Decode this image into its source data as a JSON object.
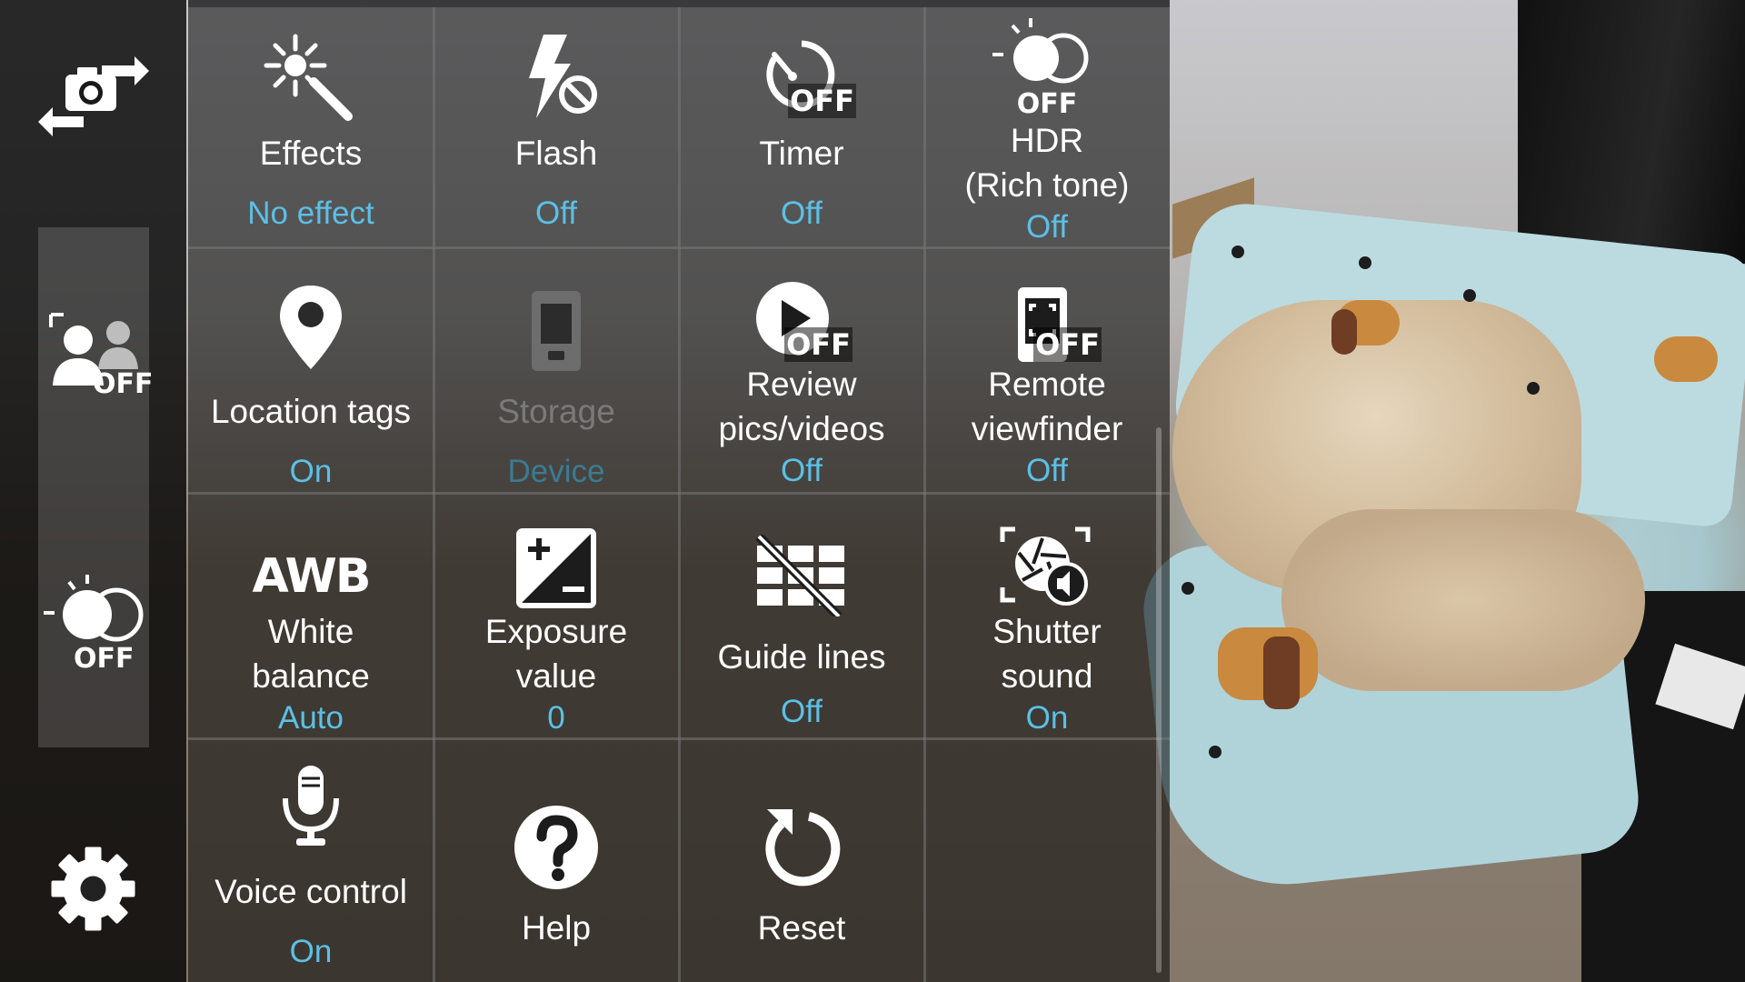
{
  "colors": {
    "accent": "#5bc0e6",
    "label": "#ffffff",
    "disabled_label": "#7a7a7a",
    "disabled_value": "#3b7b93"
  },
  "sidebar": {
    "switch_camera_icon": "switch-camera-icon",
    "face_detect": {
      "icon": "face-detection-icon",
      "state": "OFF"
    },
    "hdr_quick": {
      "icon": "hdr-icon",
      "state": "OFF"
    },
    "settings_icon": "gear-icon"
  },
  "settings": {
    "effects": {
      "label": "Effects",
      "value": "No effect"
    },
    "flash": {
      "label": "Flash",
      "value": "Off"
    },
    "timer": {
      "label": "Timer",
      "value": "Off",
      "badge": "OFF"
    },
    "hdr": {
      "badge": "OFF",
      "label_line1": "HDR",
      "label_line2": "(Rich tone)",
      "value": "Off"
    },
    "location": {
      "label": "Location tags",
      "value": "On"
    },
    "storage": {
      "label": "Storage",
      "value": "Device"
    },
    "review": {
      "badge": "OFF",
      "label_line1": "Review",
      "label_line2": "pics/videos",
      "value": "Off"
    },
    "remote": {
      "badge": "OFF",
      "label_line1": "Remote",
      "label_line2": "viewfinder",
      "value": "Off"
    },
    "white_balance": {
      "icon_text": "AWB",
      "label_line1": "White",
      "label_line2": "balance",
      "value": "Auto"
    },
    "exposure": {
      "label_line1": "Exposure",
      "label_line2": "value",
      "value": "0"
    },
    "guide_lines": {
      "label": "Guide lines",
      "value": "Off"
    },
    "shutter": {
      "label_line1": "Shutter",
      "label_line2": "sound",
      "value": "On"
    },
    "voice": {
      "label": "Voice control",
      "value": "On"
    },
    "help": {
      "label": "Help"
    },
    "reset": {
      "label": "Reset"
    }
  }
}
